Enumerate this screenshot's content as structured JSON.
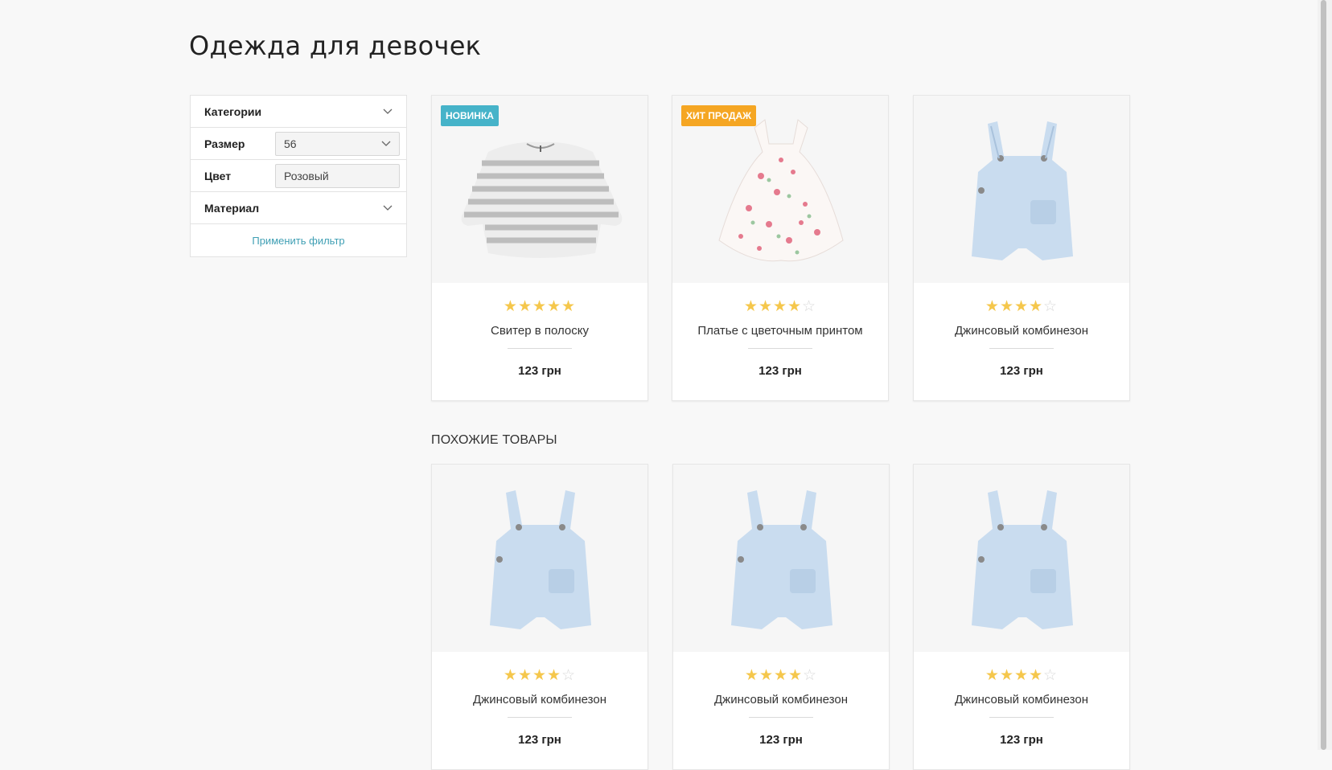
{
  "page": {
    "title": "Одежда для девочек"
  },
  "filter": {
    "categories_label": "Категории",
    "size_label": "Размер",
    "size_value": "56",
    "color_label": "Цвет",
    "color_value": "Розовый",
    "material_label": "Материал",
    "apply_label": "Применить фильтр"
  },
  "products": [
    {
      "name": "Свитер в полоску",
      "price": "123 грн",
      "rating": 5,
      "badge": "НОВИНКА",
      "badge_color": "#46b3c9",
      "image": "striped-sweater"
    },
    {
      "name": "Платье с цветочным принтом",
      "price": "123 грн",
      "rating": 4,
      "badge": "ХИТ ПРОДАЖ",
      "badge_color": "#f5a623",
      "image": "floral-dress"
    },
    {
      "name": "Джинсовый комбинезон",
      "price": "123 грн",
      "rating": 4,
      "badge": "",
      "image": "denim-overalls"
    }
  ],
  "similar": {
    "title": "ПОХОЖИЕ ТОВАРЫ",
    "products": [
      {
        "name": "Джинсовый комбинезон",
        "price": "123 грн",
        "rating": 4,
        "image": "denim-overalls"
      },
      {
        "name": "Джинсовый комбинезон",
        "price": "123 грн",
        "rating": 4,
        "image": "denim-overalls"
      },
      {
        "name": "Джинсовый комбинезон",
        "price": "123 грн",
        "rating": 4,
        "image": "denim-overalls"
      }
    ]
  },
  "colors": {
    "accent_link": "#3f9fb4",
    "star": "#f5c74c",
    "star_empty": "#d8d8d8"
  }
}
